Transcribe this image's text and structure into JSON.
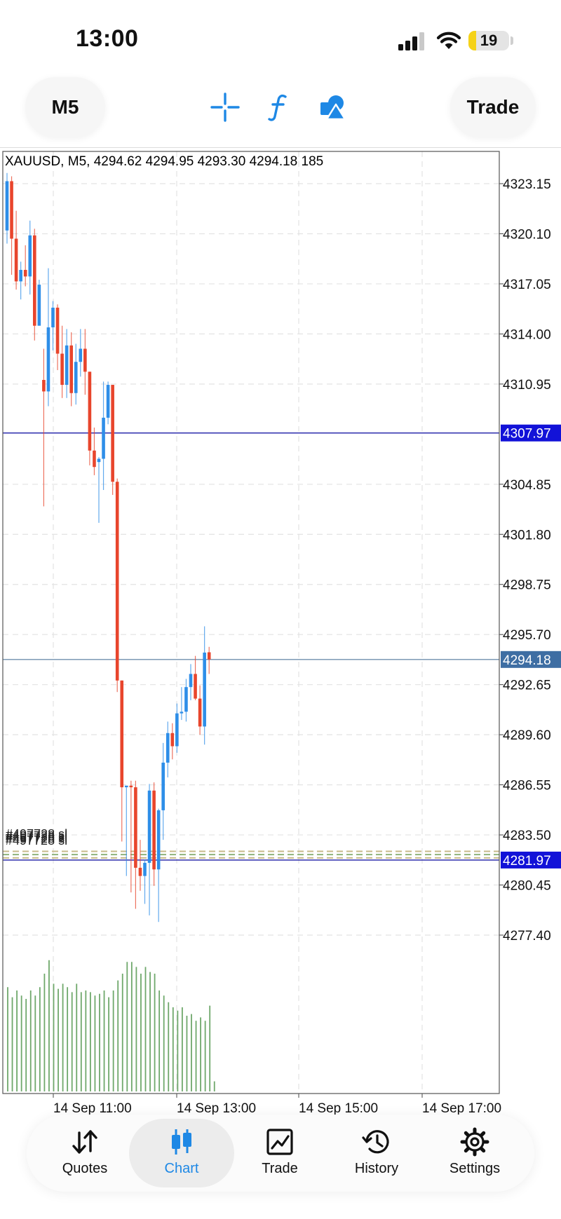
{
  "status_bar": {
    "time": "13:00",
    "battery_level": "19",
    "battery_fraction": 0.19,
    "signal_bars": 3,
    "signal_icon": "cellular-signal-icon",
    "wifi_icon": "wifi-icon"
  },
  "toolbar": {
    "timeframe_label": "M5",
    "trade_label": "Trade",
    "crosshair_icon": "crosshair-icon",
    "indicators_icon": "function-icon",
    "objects_icon": "shapes-icon",
    "accent_color": "#1e88e5"
  },
  "chart_data": {
    "type": "candlestick",
    "symbol": "XAUUSD",
    "timeframe": "M5",
    "info_line": "XAUUSD, M5, 4294.62 4294.95 4293.30 4294.18 185",
    "ohlc": {
      "open": 4294.62,
      "high": 4294.95,
      "low": 4293.3,
      "close": 4294.18,
      "volume": 185
    },
    "y_ticks": [
      4323.15,
      4320.1,
      4317.05,
      4314.0,
      4310.95,
      4304.85,
      4301.8,
      4298.75,
      4295.7,
      4292.65,
      4289.6,
      4286.55,
      4283.5,
      4280.45,
      4277.4
    ],
    "y_tick_labels": [
      "4323.15",
      "4320.10",
      "4317.05",
      "4314.00",
      "4310.95",
      "4304.85",
      "4301.80",
      "4298.75",
      "4295.70",
      "4292.65",
      "4289.60",
      "4286.55",
      "4283.50",
      "4280.45",
      "4277.40"
    ],
    "x_tick_labels": [
      "14 Sep 11:00",
      "14 Sep 13:00",
      "14 Sep 15:00",
      "14 Sep 17:00"
    ],
    "price_lines": [
      {
        "value": 4307.97,
        "label": "4307.97",
        "color": "#1a1aa6",
        "label_bg": "#1212d8"
      },
      {
        "value": 4294.18,
        "label": "4294.18",
        "color": "#6f8fae",
        "label_bg": "#3e6ea3"
      },
      {
        "value": 4281.97,
        "label": "4281.97",
        "color": "#1a1aa6",
        "label_bg": "#1212d8"
      }
    ],
    "order_levels": [
      4282.5,
      4282.3,
      4282.1
    ],
    "order_labels_text": "#497728 sl",
    "bull_color": "#2e8ee8",
    "bear_color": "#e8452c",
    "volume_color": "#6fa86b",
    "grid": true,
    "candles": [
      {
        "o": 4320.3,
        "h": 4323.8,
        "l": 4319.5,
        "c": 4323.3
      },
      {
        "o": 4323.3,
        "h": 4323.6,
        "l": 4317.6,
        "c": 4319.8
      },
      {
        "o": 4319.8,
        "h": 4321.5,
        "l": 4316.7,
        "c": 4317.2
      },
      {
        "o": 4317.2,
        "h": 4318.4,
        "l": 4316.1,
        "c": 4317.9
      },
      {
        "o": 4317.9,
        "h": 4319.4,
        "l": 4316.9,
        "c": 4317.5
      },
      {
        "o": 4317.5,
        "h": 4320.9,
        "l": 4316.4,
        "c": 4320.0
      },
      {
        "o": 4320.0,
        "h": 4320.4,
        "l": 4313.6,
        "c": 4314.5
      },
      {
        "o": 4314.5,
        "h": 4317.3,
        "l": 4316.0,
        "c": 4317.0
      },
      {
        "o": 4311.2,
        "h": 4313.1,
        "l": 4303.5,
        "c": 4310.5
      },
      {
        "o": 4310.5,
        "h": 4318.0,
        "l": 4309.6,
        "c": 4314.4
      },
      {
        "o": 4314.4,
        "h": 4316.0,
        "l": 4313.0,
        "c": 4315.6
      },
      {
        "o": 4315.6,
        "h": 4315.8,
        "l": 4311.8,
        "c": 4312.8
      },
      {
        "o": 4312.8,
        "h": 4314.5,
        "l": 4310.1,
        "c": 4310.9
      },
      {
        "o": 4310.9,
        "h": 4314.3,
        "l": 4310.1,
        "c": 4313.3
      },
      {
        "o": 4313.3,
        "h": 4314.1,
        "l": 4309.6,
        "c": 4310.4
      },
      {
        "o": 4310.4,
        "h": 4313.4,
        "l": 4309.7,
        "c": 4312.3
      },
      {
        "o": 4312.3,
        "h": 4314.3,
        "l": 4311.4,
        "c": 4313.1
      },
      {
        "o": 4313.1,
        "h": 4314.3,
        "l": 4310.3,
        "c": 4311.7
      },
      {
        "o": 4311.7,
        "h": 4311.7,
        "l": 4306.0,
        "c": 4306.9
      },
      {
        "o": 4306.9,
        "h": 4308.3,
        "l": 4305.4,
        "c": 4305.9
      },
      {
        "o": 4306.2,
        "h": 4306.5,
        "l": 4302.5,
        "c": 4306.4
      },
      {
        "o": 4306.4,
        "h": 4311.1,
        "l": 4304.5,
        "c": 4308.9
      },
      {
        "o": 4308.9,
        "h": 4311.1,
        "l": 4308.5,
        "c": 4310.9
      },
      {
        "o": 4310.9,
        "h": 4310.9,
        "l": 4304.2,
        "c": 4305.0
      },
      {
        "o": 4305.0,
        "h": 4305.2,
        "l": 4292.2,
        "c": 4292.9
      },
      {
        "o": 4292.9,
        "h": 4292.9,
        "l": 4283.1,
        "c": 4286.4
      },
      {
        "o": 4286.4,
        "h": 4286.4,
        "l": 4281.0,
        "c": 4286.5
      },
      {
        "o": 4286.5,
        "h": 4286.8,
        "l": 4280.0,
        "c": 4286.4
      },
      {
        "o": 4286.4,
        "h": 4286.8,
        "l": 4279.0,
        "c": 4281.5
      },
      {
        "o": 4281.5,
        "h": 4283.2,
        "l": 4280.1,
        "c": 4281.0
      },
      {
        "o": 4281.0,
        "h": 4282.0,
        "l": 4279.3,
        "c": 4281.8
      },
      {
        "o": 4281.8,
        "h": 4286.6,
        "l": 4278.6,
        "c": 4286.2
      },
      {
        "o": 4286.2,
        "h": 4286.7,
        "l": 4280.4,
        "c": 4281.4
      },
      {
        "o": 4281.4,
        "h": 4285.1,
        "l": 4278.2,
        "c": 4285.0
      },
      {
        "o": 4285.0,
        "h": 4289.1,
        "l": 4283.2,
        "c": 4287.9
      },
      {
        "o": 4287.9,
        "h": 4290.4,
        "l": 4287.0,
        "c": 4289.7
      },
      {
        "o": 4289.7,
        "h": 4290.3,
        "l": 4288.1,
        "c": 4288.9
      },
      {
        "o": 4288.9,
        "h": 4291.5,
        "l": 4288.5,
        "c": 4290.9
      },
      {
        "o": 4290.9,
        "h": 4292.5,
        "l": 4290.5,
        "c": 4291.0
      },
      {
        "o": 4291.0,
        "h": 4293.0,
        "l": 4290.4,
        "c": 4292.5
      },
      {
        "o": 4292.5,
        "h": 4293.9,
        "l": 4291.7,
        "c": 4293.3
      },
      {
        "o": 4293.3,
        "h": 4294.4,
        "l": 4291.7,
        "c": 4291.8
      },
      {
        "o": 4291.8,
        "h": 4292.6,
        "l": 4289.6,
        "c": 4290.1
      },
      {
        "o": 4290.1,
        "h": 4296.2,
        "l": 4289.0,
        "c": 4294.6
      },
      {
        "o": 4294.62,
        "h": 4294.95,
        "l": 4293.3,
        "c": 4294.18
      }
    ],
    "volumes": [
      310,
      280,
      300,
      285,
      275,
      300,
      285,
      310,
      350,
      390,
      320,
      305,
      320,
      310,
      295,
      320,
      295,
      300,
      295,
      285,
      290,
      300,
      280,
      300,
      330,
      350,
      385,
      385,
      370,
      350,
      370,
      355,
      350,
      300,
      285,
      265,
      250,
      240,
      250,
      225,
      230,
      210,
      220,
      210,
      255,
      30
    ]
  },
  "bottom_nav": {
    "items": [
      {
        "label": "Quotes",
        "icon": "quotes-arrows-icon"
      },
      {
        "label": "Chart",
        "icon": "candlestick-chart-icon",
        "active": true
      },
      {
        "label": "Trade",
        "icon": "trade-chart-icon"
      },
      {
        "label": "History",
        "icon": "history-clock-icon"
      },
      {
        "label": "Settings",
        "icon": "settings-gear-icon"
      }
    ]
  }
}
